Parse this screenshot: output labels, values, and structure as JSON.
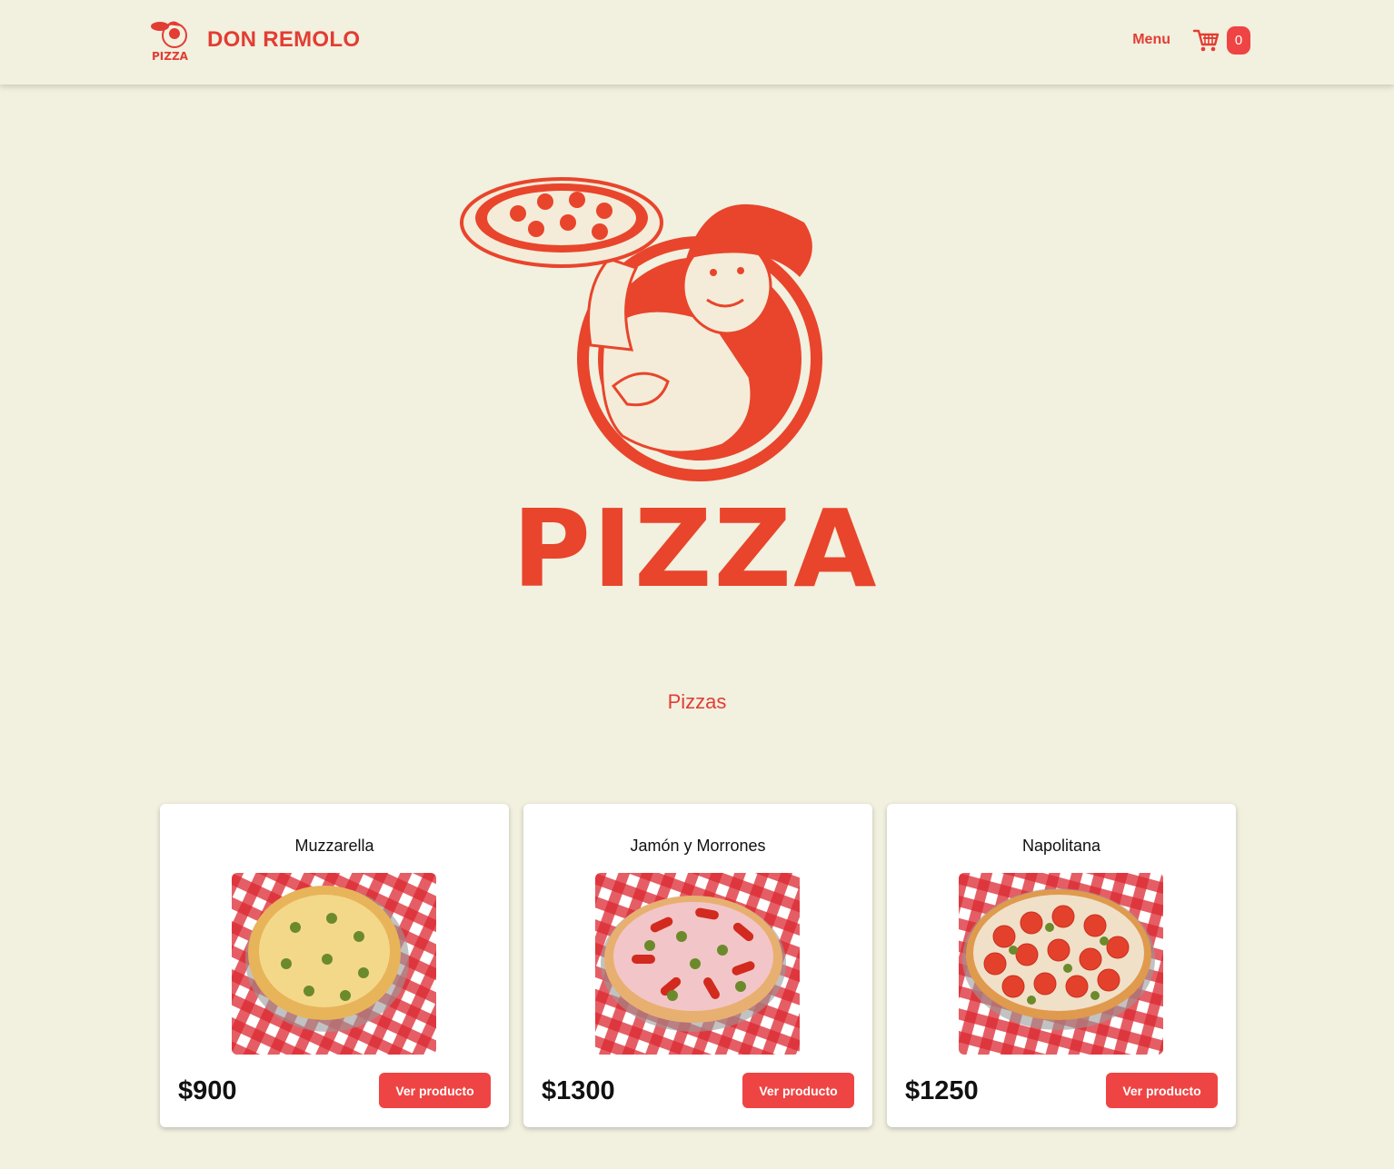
{
  "header": {
    "brand_name": "DON REMOLO",
    "logo_text": "PIZZA",
    "nav_menu_label": "Menu",
    "cart_count": "0"
  },
  "hero": {
    "logo_text": "PIZZA"
  },
  "section": {
    "title": "Pizzas"
  },
  "products": [
    {
      "name": "Muzzarella",
      "price": "$900",
      "button_label": "Ver producto"
    },
    {
      "name": "Jamón y Morrones",
      "price": "$1300",
      "button_label": "Ver producto"
    },
    {
      "name": "Napolitana",
      "price": "$1250",
      "button_label": "Ver producto"
    }
  ],
  "colors": {
    "background": "#f2f0df",
    "brand_red": "#e23d33",
    "button_red": "#ef4444",
    "card": "#ffffff"
  }
}
